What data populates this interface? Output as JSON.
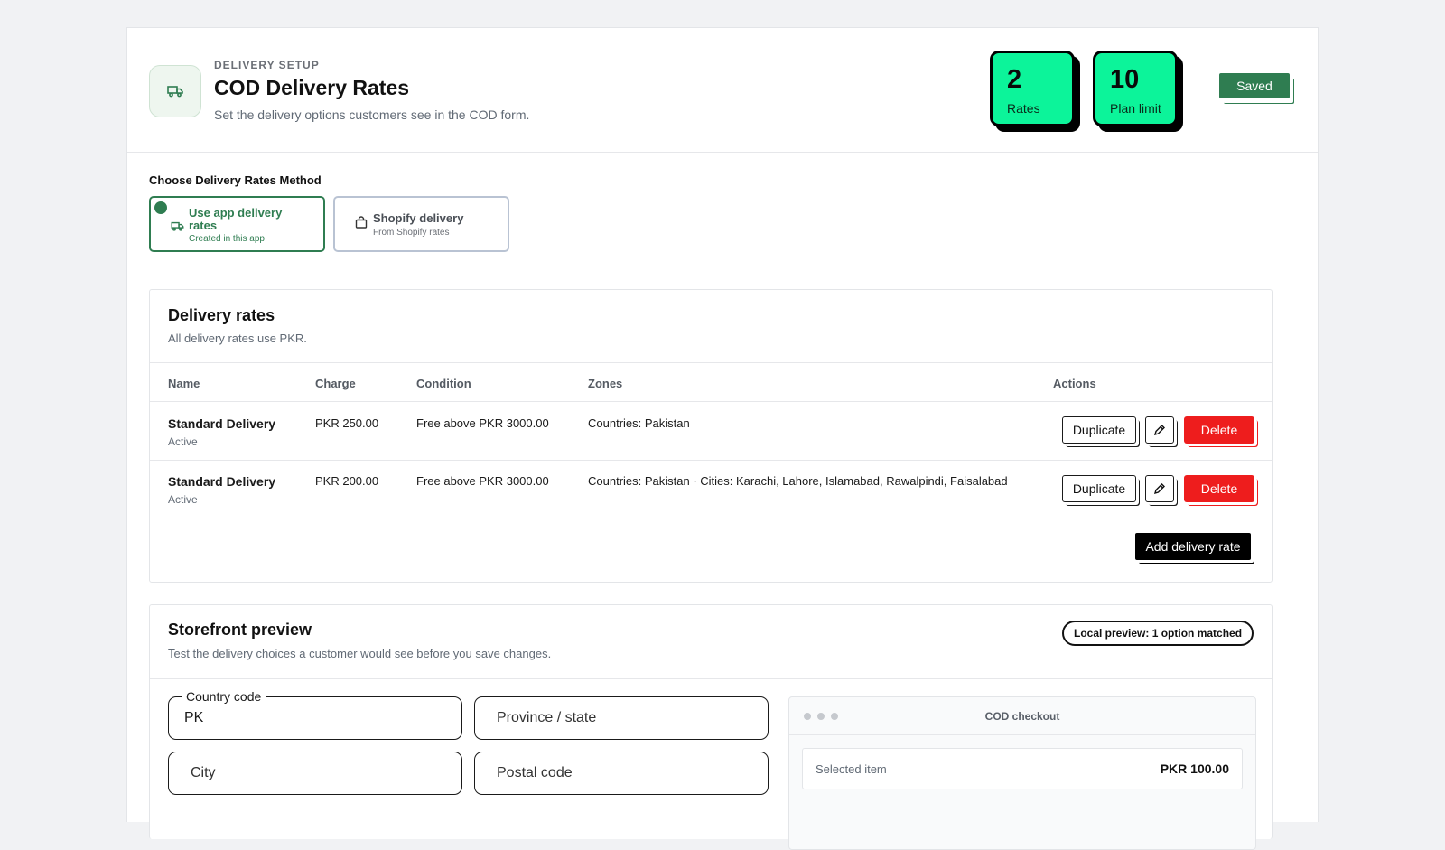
{
  "header": {
    "eyebrow": "DELIVERY SETUP",
    "title": "COD Delivery Rates",
    "subtitle": "Set the delivery options customers see in the COD form.",
    "stats": [
      {
        "value": "2",
        "label": "Rates"
      },
      {
        "value": "10",
        "label": "Plan limit"
      }
    ],
    "saved_label": "Saved",
    "icon": "truck-icon"
  },
  "method": {
    "title": "Choose Delivery Rates Method",
    "options": [
      {
        "title": "Use app delivery rates",
        "subtitle": "Created in this app",
        "icon": "truck-icon",
        "selected": true
      },
      {
        "title": "Shopify delivery",
        "subtitle": "From Shopify rates",
        "icon": "shopping-bag-icon",
        "selected": false
      }
    ]
  },
  "rates": {
    "title": "Delivery rates",
    "subtitle": "All delivery rates use PKR.",
    "columns": [
      "Name",
      "Charge",
      "Condition",
      "Zones",
      "Actions"
    ],
    "rows": [
      {
        "name": "Standard Delivery",
        "status": "Active",
        "charge": "PKR 250.00",
        "condition": "Free above PKR 3000.00",
        "zones": "Countries: Pakistan"
      },
      {
        "name": "Standard Delivery",
        "status": "Active",
        "charge": "PKR 200.00",
        "condition": "Free above PKR 3000.00",
        "zones": "Countries: Pakistan · Cities: Karachi, Lahore, Islamabad, Rawalpindi, Faisalabad"
      }
    ],
    "duplicate_label": "Duplicate",
    "delete_label": "Delete",
    "add_label": "Add delivery rate"
  },
  "preview": {
    "title": "Storefront preview",
    "subtitle": "Test the delivery choices a customer would see before you save changes.",
    "badge": "Local preview: 1 option matched",
    "fields": {
      "country_label": "Country code",
      "country_value": "PK",
      "province_placeholder": "Province / state",
      "city_placeholder": "City",
      "postal_placeholder": "Postal code"
    },
    "checkout": {
      "title": "COD checkout",
      "item_label": "Selected item",
      "item_value": "PKR 100.00"
    }
  },
  "colors": {
    "accent_green": "#2f7d51",
    "stat_green": "#0cf49a",
    "danger": "#ee1d1d"
  }
}
